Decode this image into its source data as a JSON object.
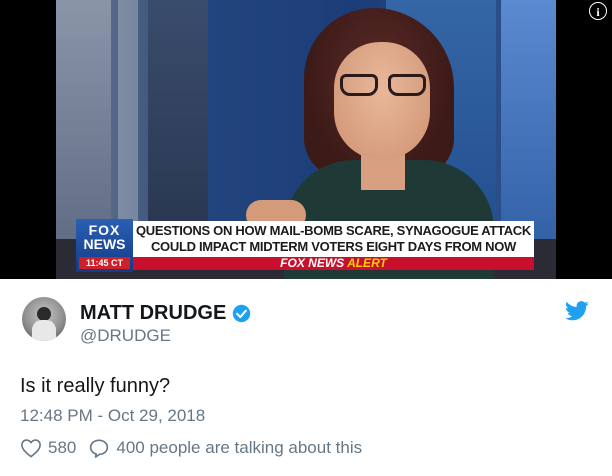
{
  "video": {
    "network_logo_line1": "FOX",
    "network_logo_line2": "NEWS",
    "time": "11:45 CT",
    "headline_line1": "QUESTIONS ON HOW MAIL-BOMB SCARE, SYNAGOGUE ATTACK",
    "headline_line2": "COULD IMPACT MIDTERM VOTERS EIGHT DAYS FROM NOW",
    "alert_brand": "FOX NEWS",
    "alert_word": "ALERT",
    "info_icon": "info-icon"
  },
  "tweet": {
    "display_name": "MATT DRUDGE",
    "handle": "@DRUDGE",
    "verified": true,
    "text": "Is it really funny?",
    "timestamp": "12:48 PM - Oct 29, 2018",
    "likes": "580",
    "talking": "400 people are talking about this"
  },
  "colors": {
    "twitter_blue": "#1da1f2",
    "secondary_text": "#657786",
    "alert_red": "#c8102e",
    "alert_yellow": "#ffd200"
  }
}
